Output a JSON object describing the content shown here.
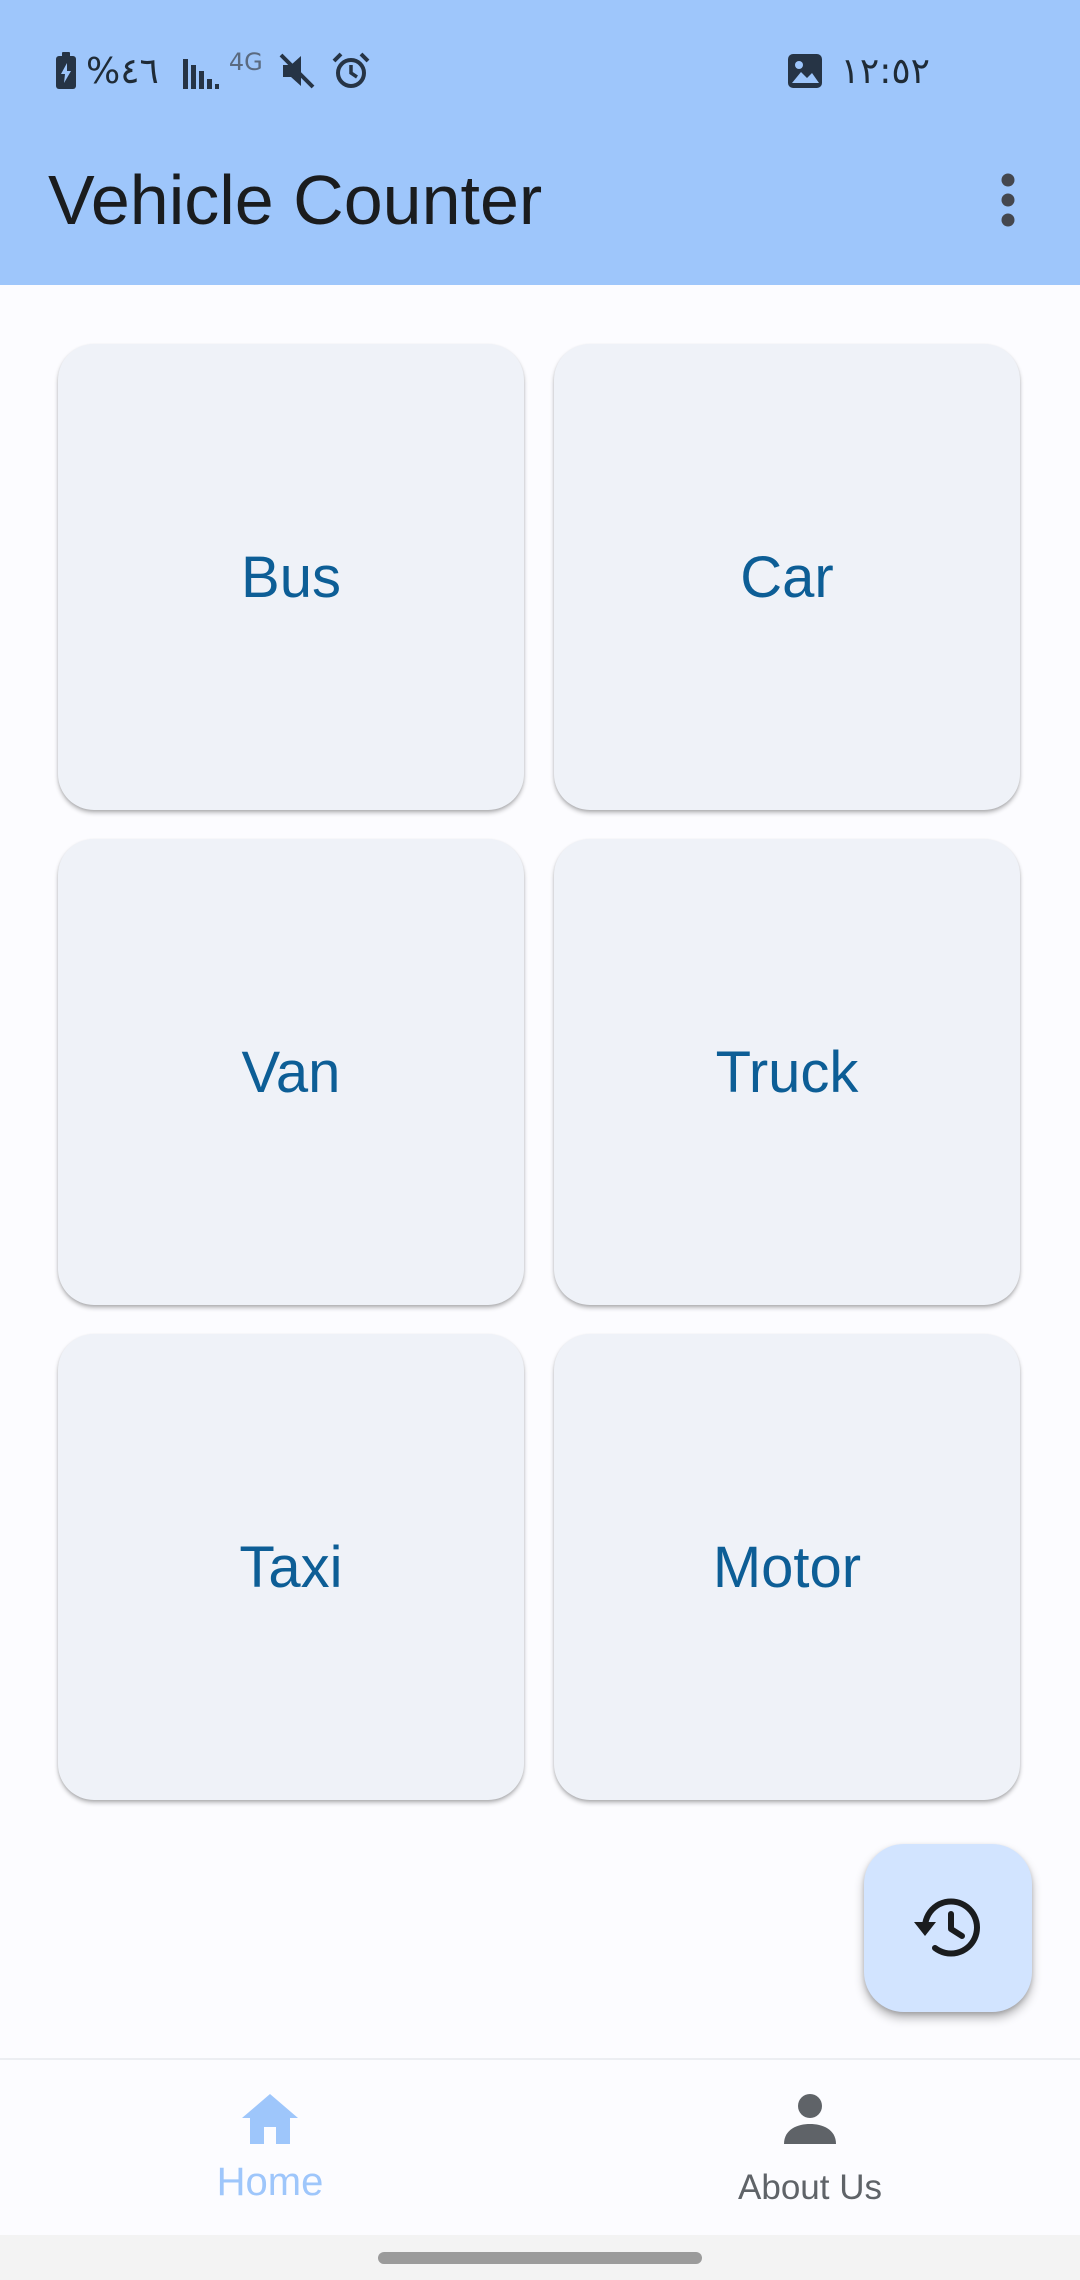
{
  "status_bar": {
    "battery_text": "%٤٦",
    "network_text": "4G",
    "time": "١٢:٥٢"
  },
  "app_bar": {
    "title": "Vehicle Counter",
    "more_icon": "more-vert-icon"
  },
  "vehicles": [
    {
      "label": "Bus"
    },
    {
      "label": "Car"
    },
    {
      "label": "Van"
    },
    {
      "label": "Truck"
    },
    {
      "label": "Taxi"
    },
    {
      "label": "Motor"
    }
  ],
  "fab": {
    "icon": "history-icon"
  },
  "bottom_nav": {
    "items": [
      {
        "label": "Home",
        "icon": "home-icon",
        "selected": true
      },
      {
        "label": "About Us",
        "icon": "person-icon",
        "selected": false
      }
    ]
  },
  "colors": {
    "app_bar": "#9ec6fb",
    "card": "#eff2f8",
    "card_text": "#0d5e96",
    "fab": "#d2e4ff",
    "nav_selected": "#9ec6fb",
    "nav_unselected": "#5f6368"
  }
}
